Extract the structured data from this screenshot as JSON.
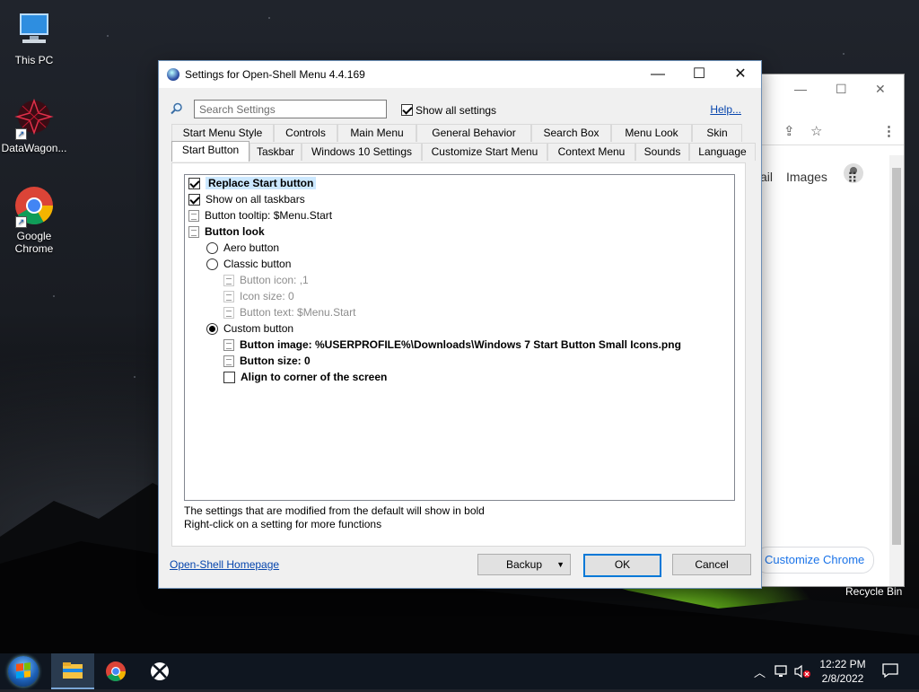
{
  "desktop": {
    "icons": [
      {
        "label": "This PC"
      },
      {
        "label": "DataWagon..."
      },
      {
        "label": "Google Chrome"
      }
    ],
    "recycle_bin": "Recycle Bin"
  },
  "browser": {
    "nav_link": "ail",
    "images_link": "Images",
    "customize_label": "Customize Chrome"
  },
  "dialog": {
    "title": "Settings for Open-Shell Menu 4.4.169",
    "search_placeholder": "Search Settings",
    "show_all_label": "Show all settings",
    "show_all_checked": true,
    "help_label": "Help...",
    "tabs_row1": [
      "Start Menu Style",
      "Controls",
      "Main Menu",
      "General Behavior",
      "Search Box",
      "Menu Look",
      "Skin"
    ],
    "tabs_row2": [
      "Start Button",
      "Taskbar",
      "Windows 10 Settings",
      "Customize Start Menu",
      "Context Menu",
      "Sounds",
      "Language"
    ],
    "active_tab": "Start Button",
    "settings": {
      "replace_start": "Replace Start button",
      "show_all_taskbars": "Show on all taskbars",
      "button_tooltip": "Button tooltip: $Menu.Start",
      "button_look": "Button look",
      "aero_button": "Aero button",
      "classic_button": "Classic button",
      "button_icon": "Button icon: ,1",
      "icon_size": "Icon size: 0",
      "button_text": "Button text: $Menu.Start",
      "custom_button": "Custom button",
      "button_image": "Button image: %USERPROFILE%\\Downloads\\Windows 7 Start Button Small Icons.png",
      "button_size": "Button size: 0",
      "align_corner": "Align to corner of the screen"
    },
    "hint_line1": "The settings that are modified from the default will show in bold",
    "hint_line2": "Right-click on a setting for more functions",
    "homepage_link": "Open-Shell Homepage",
    "backup_label": "Backup",
    "ok_label": "OK",
    "cancel_label": "Cancel"
  },
  "taskbar": {
    "time": "12:22 PM",
    "date": "2/8/2022"
  }
}
